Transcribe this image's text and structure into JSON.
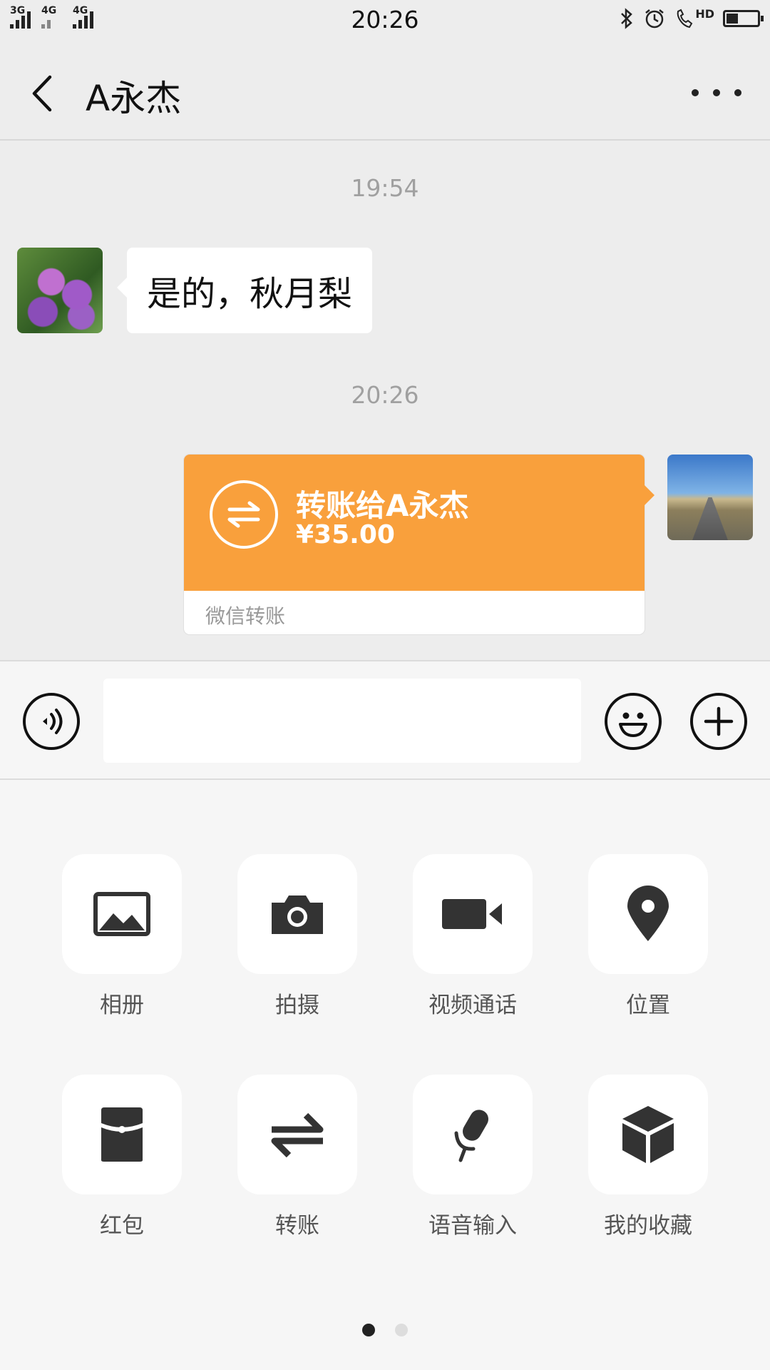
{
  "status_bar": {
    "time": "20:26",
    "signal1_label": "3G",
    "signal2_label": "4G",
    "signal3_label": "4G",
    "hd_label": "HD",
    "battery_level": 0.35
  },
  "header": {
    "title": "A永杰",
    "back_icon": "chevron-left-icon",
    "more_icon": "more-icon"
  },
  "chat": {
    "messages": [
      {
        "timestamp": "19:54",
        "type": "text",
        "direction": "incoming",
        "text": "是的，秋月梨"
      },
      {
        "timestamp": "20:26",
        "type": "transfer",
        "direction": "outgoing",
        "title": "转账给A永杰",
        "amount": "¥35.00",
        "footer": "微信转账",
        "accent": "#f9a03c"
      }
    ]
  },
  "input_bar": {
    "voice_icon": "voice-icon",
    "emoji_icon": "emoji-icon",
    "plus_icon": "plus-icon",
    "value": "",
    "placeholder": ""
  },
  "tools": {
    "items": [
      {
        "icon": "album-icon",
        "label": "相册"
      },
      {
        "icon": "camera-icon",
        "label": "拍摄"
      },
      {
        "icon": "video-call-icon",
        "label": "视频通话"
      },
      {
        "icon": "location-icon",
        "label": "位置"
      },
      {
        "icon": "red-packet-icon",
        "label": "红包"
      },
      {
        "icon": "transfer-icon",
        "label": "转账"
      },
      {
        "icon": "microphone-icon",
        "label": "语音输入"
      },
      {
        "icon": "favorites-icon",
        "label": "我的收藏"
      }
    ],
    "page_count": 2,
    "active_page": 1
  }
}
